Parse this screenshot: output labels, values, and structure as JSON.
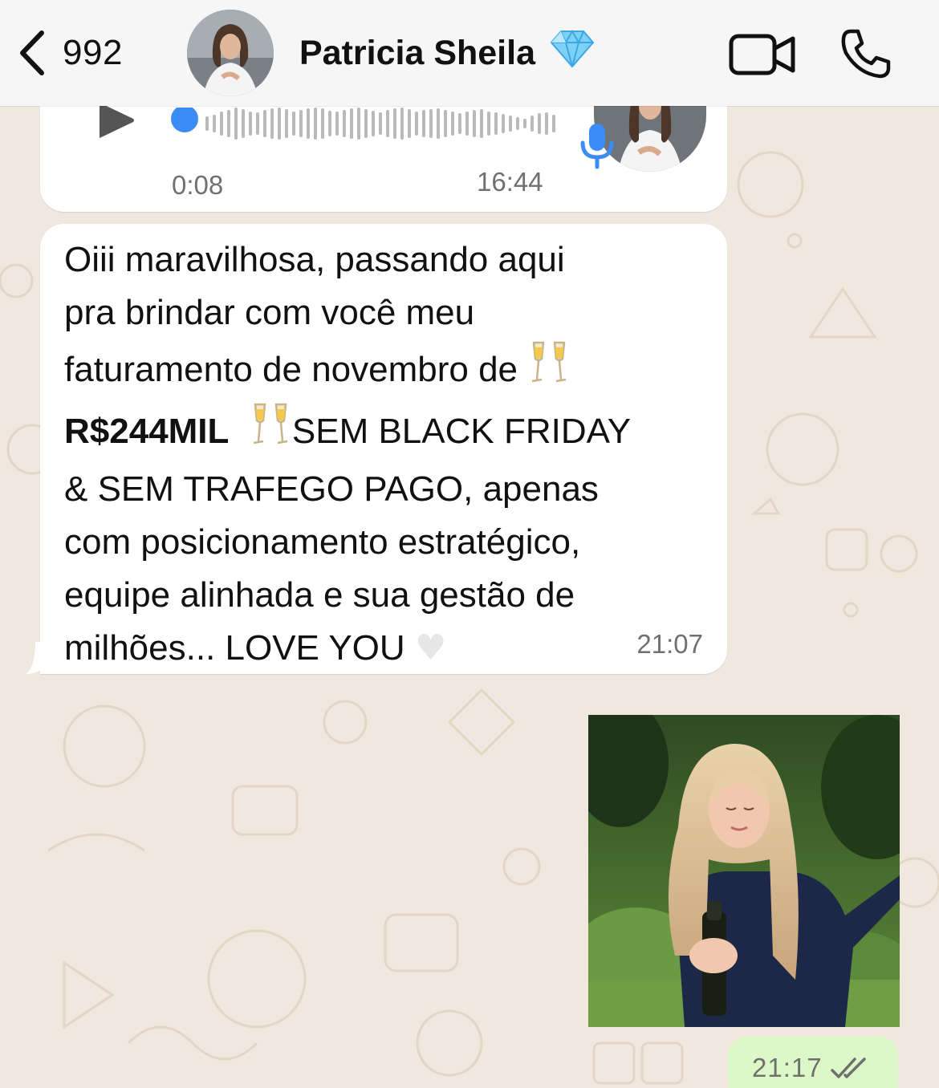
{
  "header": {
    "back_count": "992",
    "contact_name": "Patricia Sheila",
    "contact_badge_icon": "gem-icon"
  },
  "messages": {
    "audio": {
      "duration": "0:08",
      "time": "16:44"
    },
    "text": {
      "line1": "Oiii maravilhosa, passando aqui",
      "line2": "pra brindar com você meu",
      "line3": "faturamento de novembro de",
      "line4_bold": "R$244MIL",
      "line4_rest": "SEM BLACK FRIDAY",
      "line5": "& SEM TRAFEGO PAGO, apenas",
      "line6": "com posicionamento estratégico,",
      "line7": "equipe alinhada e sua gestão de",
      "line8": "milhões... LOVE YOU",
      "heart": "🤍",
      "time": "21:07"
    },
    "image": {
      "time": "21:17",
      "status_icon": "double-check-icon"
    }
  },
  "colors": {
    "outgoing_bubble": "#dcf8c6",
    "incoming_bubble": "#ffffff",
    "accent_blue": "#3b8cf5",
    "wallpaper": "#f0e8de"
  }
}
